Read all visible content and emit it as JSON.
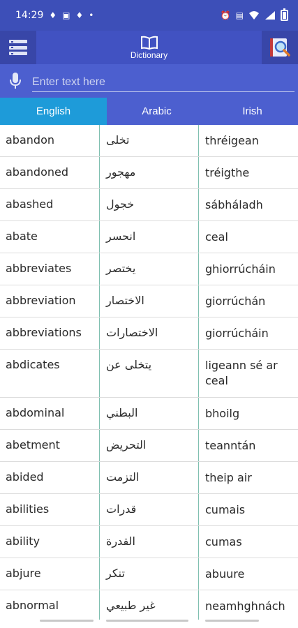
{
  "status_bar": {
    "time": "14:29",
    "dot": "•"
  },
  "appbar": {
    "title": "Dictionary"
  },
  "search": {
    "placeholder": "Enter text here"
  },
  "tabs": [
    {
      "label": "English",
      "active": true
    },
    {
      "label": "Arabic",
      "active": false
    },
    {
      "label": "Irish",
      "active": false
    }
  ],
  "columns": [
    "English",
    "Arabic",
    "Irish"
  ],
  "rows": [
    {
      "en": "abandon",
      "ar": "تخلى",
      "ga": "thréigean"
    },
    {
      "en": "abandoned",
      "ar": "مهجور",
      "ga": "tréigthe"
    },
    {
      "en": "abashed",
      "ar": "خجول",
      "ga": "sábháladh"
    },
    {
      "en": "abate",
      "ar": "انحسر",
      "ga": "ceal"
    },
    {
      "en": "abbreviates",
      "ar": "يختصر",
      "ga": "ghiorrúcháin"
    },
    {
      "en": "abbreviation",
      "ar": "الاختصار",
      "ga": "giorrúchán"
    },
    {
      "en": "abbreviations",
      "ar": "الاختصارات",
      "ga": "giorrúcháin"
    },
    {
      "en": "abdicates",
      "ar": "يتخلى عن",
      "ga": "ligeann sé ar ceal"
    },
    {
      "en": "abdominal",
      "ar": "البطني",
      "ga": "bhoilg"
    },
    {
      "en": "abetment",
      "ar": "التحريض",
      "ga": "teanntán"
    },
    {
      "en": "abided",
      "ar": "التزمت",
      "ga": "theip air"
    },
    {
      "en": "abilities",
      "ar": "قدرات",
      "ga": "cumais"
    },
    {
      "en": "ability",
      "ar": "القدرة",
      "ga": "cumas"
    },
    {
      "en": "abjure",
      "ar": "تنكر",
      "ga": "abuure"
    },
    {
      "en": "abnormal",
      "ar": "غير طبيعي",
      "ga": "neamhghnách"
    }
  ],
  "colors": {
    "primary": "#3d4fb8",
    "search_bg": "#4c5fcf",
    "active_tab": "#1e9bd9",
    "divider": "#7fbfb0"
  }
}
